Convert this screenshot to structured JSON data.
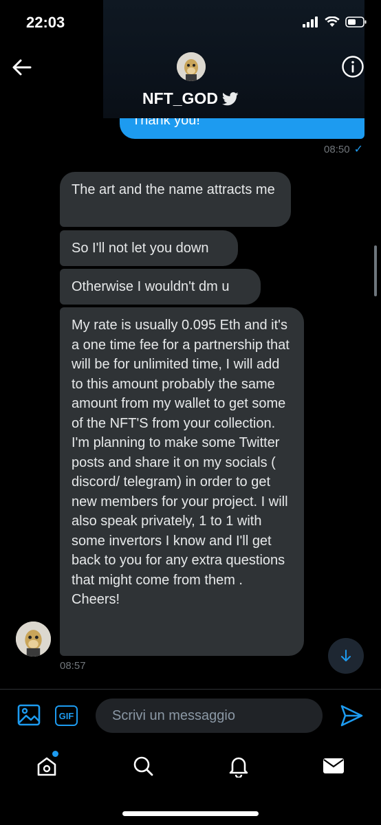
{
  "status_bar": {
    "time": "22:03"
  },
  "header": {
    "display_name": "NFT_GOD",
    "verified_badge": "twitter-bird-icon"
  },
  "conversation": {
    "sent": {
      "text": "Thank you!",
      "time": "08:50",
      "read_receipt": "✓"
    },
    "received": [
      {
        "text": "The art and the name attracts me"
      },
      {
        "text": "So I'll not let you down"
      },
      {
        "text": "Otherwise I wouldn't dm u"
      },
      {
        "text": "My rate is usually 0.095 Eth and it's a one  time fee for a partnership that will be for unlimited time, I will add to this amount probably the same amount from my wallet to get some of the NFT'S from your collection. I'm planning to make some Twitter posts and share it on my socials ( discord/ telegram) in order to get new members for your project. I will also speak privately, 1 to 1 with some invertors I know and I'll get back to you for any extra questions that might come from them . Cheers!"
      }
    ],
    "received_time": "08:57"
  },
  "composer": {
    "gif_label": "GIF",
    "placeholder": "Scrivi un messaggio"
  },
  "tab_bar": {
    "items": [
      "home-icon",
      "search-icon",
      "bell-icon",
      "mail-icon"
    ]
  },
  "colors": {
    "accent": "#1d9bf0",
    "bubble": "#2f3336",
    "background": "#000000",
    "muted": "#71767b"
  }
}
